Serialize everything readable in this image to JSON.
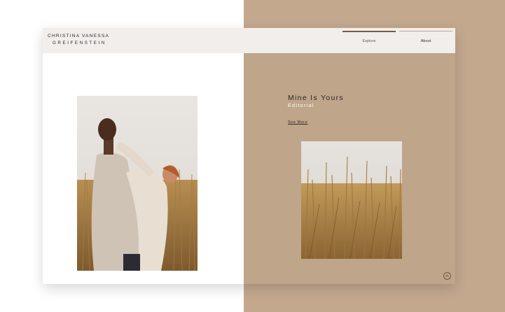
{
  "site": {
    "logo": {
      "line1": "CHRISTINA VANESSA",
      "line2": "GREIFENSTEIN"
    },
    "nav": [
      {
        "label": "Explore",
        "active": true
      },
      {
        "label": "About",
        "active": false
      }
    ]
  },
  "post": {
    "title": "Mine Is Yours",
    "subtitle": "Editorial",
    "link_label": "See More"
  },
  "icons": {
    "scroll_top": "chevron-up-circle-icon"
  },
  "colors": {
    "page_accent": "#c3a88e",
    "panel_tan": "#bfa58a",
    "header_bg": "#f1eeeb",
    "nav_active_bar": "#7b5a43"
  }
}
